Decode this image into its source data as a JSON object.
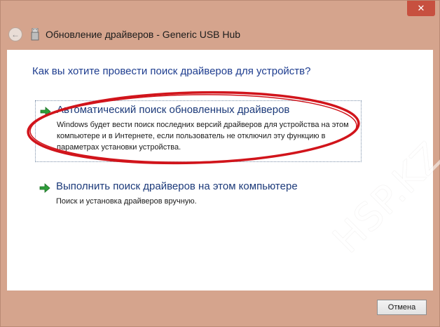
{
  "window": {
    "title": "Обновление драйверов - Generic USB Hub",
    "close_glyph": "✕"
  },
  "main": {
    "heading": "Как вы хотите провести поиск драйверов для устройств?",
    "options": [
      {
        "title": "Автоматический поиск обновленных драйверов",
        "description": "Windows будет вести поиск последних версий драйверов для устройства на этом компьютере и в Интернете, если пользователь не отключил эту функцию в параметрах установки устройства."
      },
      {
        "title": "Выполнить поиск драйверов на этом компьютере",
        "description": "Поиск и установка драйверов вручную."
      }
    ]
  },
  "footer": {
    "cancel_label": "Отмена"
  },
  "watermark": {
    "text": "HSP.KZ"
  },
  "colors": {
    "window_frame": "#d5a48d",
    "close_button": "#c7503f",
    "heading_blue": "#1e3d8f",
    "arrow_green": "#2e9e3a",
    "annotation_red": "#d1141b"
  }
}
